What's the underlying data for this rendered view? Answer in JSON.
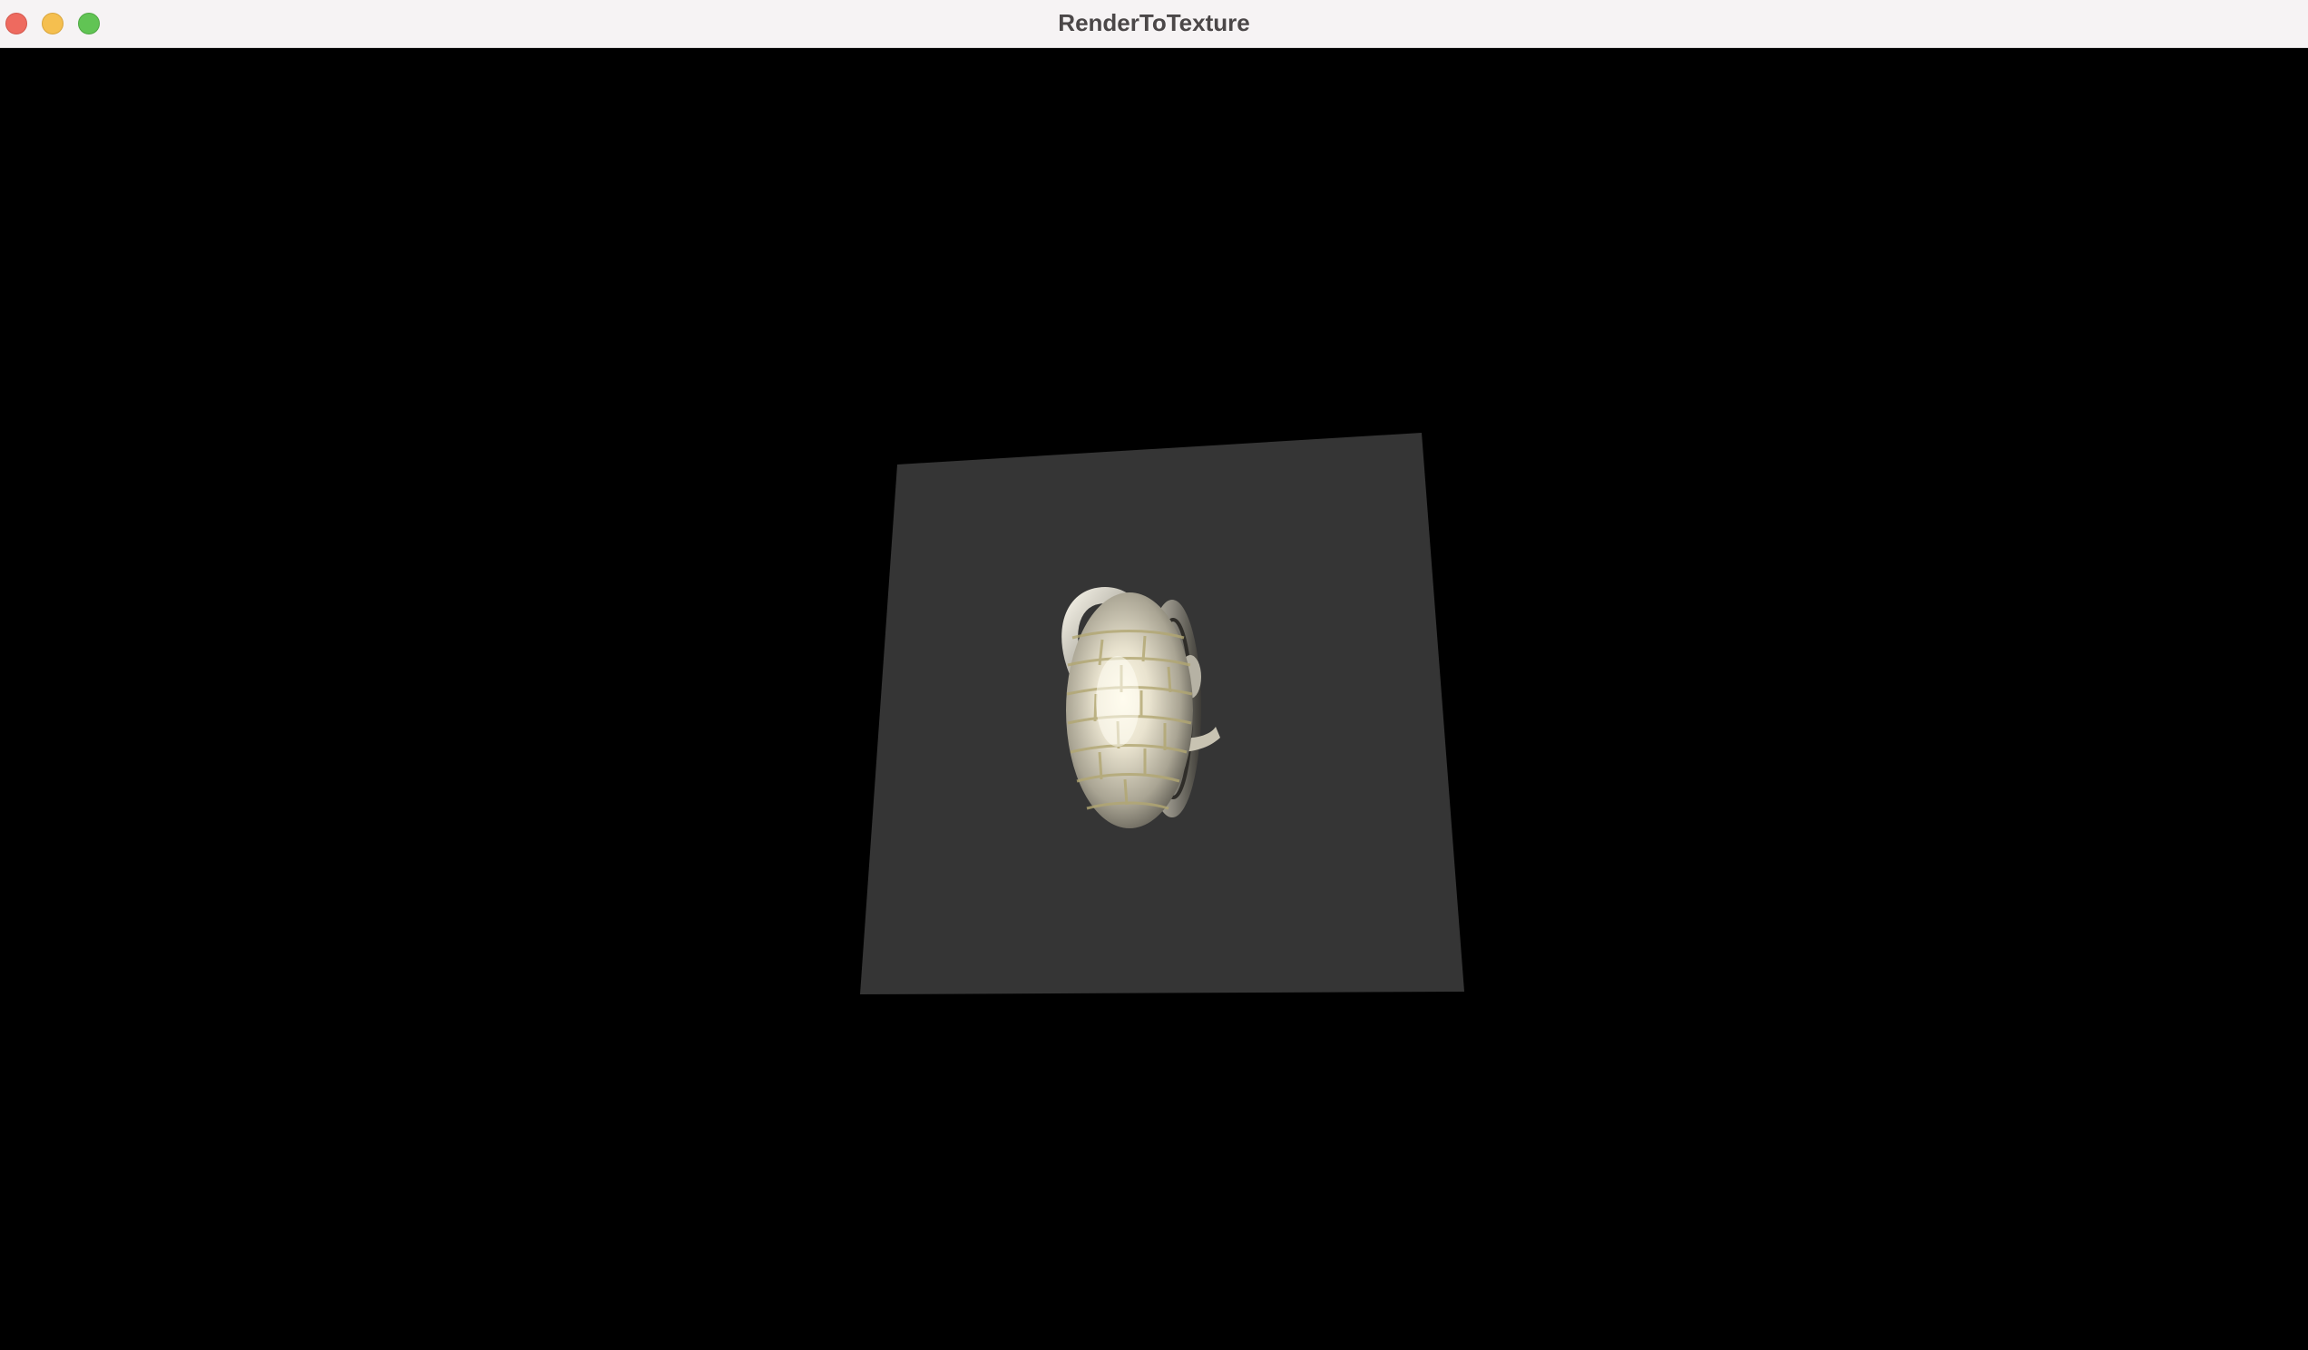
{
  "window": {
    "title": "RenderToTexture"
  },
  "controls": {
    "close_icon": "close-icon",
    "minimize_icon": "minimize-icon",
    "maximize_icon": "maximize-icon"
  },
  "colors": {
    "background": "#000000",
    "quad": "#353535",
    "titlebar": "#f6f3f4",
    "close": "#ee6a5f",
    "minimize": "#f5bf4f",
    "maximize": "#61c454"
  }
}
